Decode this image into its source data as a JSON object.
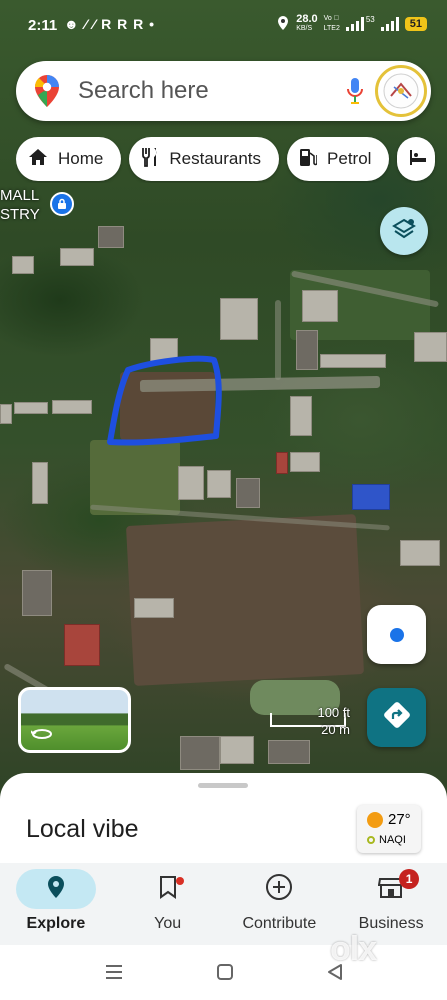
{
  "status_bar": {
    "time": "2:11",
    "notifications": "☻ ⁄ ⁄ R R R •",
    "speed_value": "28.0",
    "speed_unit": "KB/S",
    "network_top": "Vo ⃞",
    "network_bottom": "LTE2",
    "signal_label": "53",
    "battery": "51"
  },
  "search": {
    "placeholder": "Search here",
    "icon": "google-maps-pin-icon",
    "mic_icon": "mic-icon"
  },
  "chips": [
    {
      "label": "Home",
      "icon": "home-icon"
    },
    {
      "label": "Restaurants",
      "icon": "restaurant-icon"
    },
    {
      "label": "Petrol",
      "icon": "fuel-icon"
    },
    {
      "label": "",
      "icon": "hotel-icon"
    }
  ],
  "map": {
    "label_line1": "MALL",
    "label_line2": "STRY",
    "scale_ft": "100 ft",
    "scale_m": "20 m",
    "outline_color": "#1e4fe0"
  },
  "sheet": {
    "title": "Local vibe",
    "weather_temp": "27°",
    "weather_aqi": "NAQI"
  },
  "nav": {
    "items": [
      {
        "label": "Explore",
        "icon": "explore-pin-icon",
        "active": true
      },
      {
        "label": "You",
        "icon": "bookmark-icon",
        "dot": true
      },
      {
        "label": "Contribute",
        "icon": "add-circle-icon"
      },
      {
        "label": "Business",
        "icon": "store-icon",
        "badge": "1"
      }
    ]
  },
  "watermark": "olx",
  "colors": {
    "accent_blue": "#1a73e8",
    "directions_teal": "#0f7383",
    "explore_pill": "#c4e8f3",
    "badge_red": "#c5221f"
  }
}
